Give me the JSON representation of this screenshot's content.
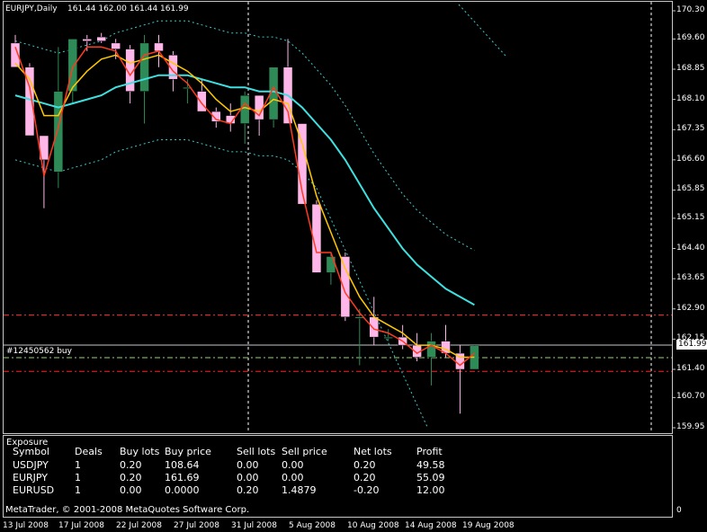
{
  "header": {
    "symbol_period": "EURJPY,Daily",
    "ohlc": "161.44 162.00 161.44 161.99"
  },
  "price_axis": {
    "ticks": [
      "170.30",
      "169.60",
      "168.85",
      "168.10",
      "167.35",
      "166.60",
      "165.85",
      "165.15",
      "164.40",
      "163.65",
      "162.90",
      "162.15",
      "161.40",
      "160.70",
      "159.95"
    ],
    "current_price": "161.99",
    "range": [
      159.95,
      170.3
    ]
  },
  "time_axis": {
    "ticks": [
      "13 Jul 2008",
      "17 Jul 2008",
      "22 Jul 2008",
      "27 Jul 2008",
      "31 Jul 2008",
      "5 Aug 2008",
      "10 Aug 2008",
      "14 Aug 2008",
      "19 Aug 2008"
    ]
  },
  "order_line": {
    "label": "#12450562 buy",
    "open_price": 161.69
  },
  "levels": {
    "resistance_red": 162.75,
    "support_red": 161.35
  },
  "colors": {
    "bull_candle": "#2e8b57",
    "bear_candle": "#ffb6e8",
    "ema_fast": "#ff3b1f",
    "ema_slow": "#ffc800",
    "ma_long": "#3ee0e0",
    "band": "#3ec8c8",
    "level_line": "#ff2020",
    "order_line": "#9bd46b",
    "vertical_separator": "#ffffff"
  },
  "exposure": {
    "title": "Exposure",
    "columns": [
      "Symbol",
      "Deals",
      "Buy lots",
      "Buy price",
      "Sell lots",
      "Sell price",
      "Net lots",
      "Profit"
    ],
    "rows": [
      [
        "USDJPY",
        "1",
        "0.20",
        "108.64",
        "0.00",
        "0.00",
        "0.20",
        "49.58"
      ],
      [
        "EURJPY",
        "1",
        "0.20",
        "161.69",
        "0.00",
        "0.00",
        "0.20",
        "55.09"
      ],
      [
        "EURUSD",
        "1",
        "0.00",
        "0.0000",
        "0.20",
        "1.4879",
        "-0.20",
        "12.00"
      ]
    ],
    "footer": "MetaTrader, © 2001-2008 MetaQuotes Software Corp.",
    "scale_label": "0"
  },
  "candles": [
    {
      "o": 169.5,
      "h": 169.7,
      "l": 168.9,
      "c": 168.9
    },
    {
      "o": 168.9,
      "h": 169.0,
      "l": 167.2,
      "c": 167.2
    },
    {
      "o": 167.2,
      "h": 166.65,
      "l": 165.4,
      "c": 166.6
    },
    {
      "o": 166.3,
      "h": 169.4,
      "l": 165.9,
      "c": 168.3
    },
    {
      "o": 168.3,
      "h": 169.6,
      "l": 168.0,
      "c": 169.6
    },
    {
      "o": 169.6,
      "h": 169.7,
      "l": 169.3,
      "c": 169.55
    },
    {
      "o": 169.65,
      "h": 169.75,
      "l": 169.5,
      "c": 169.55
    },
    {
      "o": 169.5,
      "h": 169.6,
      "l": 169.1,
      "c": 169.35
    },
    {
      "o": 169.35,
      "h": 169.45,
      "l": 168.0,
      "c": 168.3
    },
    {
      "o": 168.3,
      "h": 169.7,
      "l": 167.5,
      "c": 169.5
    },
    {
      "o": 169.5,
      "h": 169.7,
      "l": 168.9,
      "c": 169.3
    },
    {
      "o": 169.2,
      "h": 169.3,
      "l": 168.3,
      "c": 168.6
    },
    {
      "o": 168.4,
      "h": 168.6,
      "l": 168.0,
      "c": 168.4
    },
    {
      "o": 168.3,
      "h": 168.6,
      "l": 167.8,
      "c": 167.8
    },
    {
      "o": 167.8,
      "h": 167.9,
      "l": 167.4,
      "c": 167.55
    },
    {
      "o": 167.7,
      "h": 168.0,
      "l": 167.3,
      "c": 167.5
    },
    {
      "o": 167.5,
      "h": 168.3,
      "l": 167.0,
      "c": 168.2
    },
    {
      "o": 168.2,
      "h": 168.2,
      "l": 167.2,
      "c": 167.6
    },
    {
      "o": 167.6,
      "h": 168.9,
      "l": 167.4,
      "c": 168.9
    },
    {
      "o": 168.9,
      "h": 169.6,
      "l": 167.5,
      "c": 167.5
    },
    {
      "o": 167.5,
      "h": 167.5,
      "l": 165.5,
      "c": 165.5
    },
    {
      "o": 165.5,
      "h": 165.6,
      "l": 163.8,
      "c": 163.8
    },
    {
      "o": 163.8,
      "h": 164.3,
      "l": 163.5,
      "c": 164.2
    },
    {
      "o": 164.2,
      "h": 164.3,
      "l": 162.6,
      "c": 162.7
    },
    {
      "o": 162.7,
      "h": 162.9,
      "l": 161.5,
      "c": 162.7
    },
    {
      "o": 162.7,
      "h": 163.2,
      "l": 162.0,
      "c": 162.2
    },
    {
      "o": 162.2,
      "h": 162.4,
      "l": 162.1,
      "c": 162.2
    },
    {
      "o": 162.2,
      "h": 162.5,
      "l": 161.9,
      "c": 162.0
    },
    {
      "o": 162.0,
      "h": 162.3,
      "l": 161.6,
      "c": 161.7
    },
    {
      "o": 161.7,
      "h": 162.3,
      "l": 161.0,
      "c": 162.1
    },
    {
      "o": 162.1,
      "h": 162.5,
      "l": 161.7,
      "c": 161.8
    },
    {
      "o": 161.8,
      "h": 162.0,
      "l": 160.3,
      "c": 161.4
    },
    {
      "o": 161.4,
      "h": 162.0,
      "l": 161.4,
      "c": 161.99
    }
  ],
  "ema_fast": [
    169.4,
    168.4,
    166.2,
    167.4,
    168.9,
    169.4,
    169.4,
    169.3,
    168.7,
    169.2,
    169.3,
    168.8,
    168.5,
    168.0,
    167.6,
    167.5,
    168.0,
    167.7,
    168.4,
    167.8,
    165.8,
    164.3,
    164.3,
    163.3,
    162.8,
    162.4,
    162.3,
    162.1,
    161.8,
    162.0,
    161.8,
    161.5,
    161.8
  ],
  "ema_slow": [
    169.0,
    168.6,
    167.7,
    167.7,
    168.4,
    168.8,
    169.1,
    169.2,
    169.0,
    169.1,
    169.2,
    169.0,
    168.8,
    168.5,
    168.1,
    167.8,
    167.9,
    167.8,
    168.1,
    168.0,
    167.0,
    165.7,
    164.8,
    163.9,
    163.2,
    162.7,
    162.5,
    162.3,
    162.0,
    162.0,
    161.9,
    161.7,
    161.7
  ],
  "ma_long": [
    168.2,
    168.1,
    168.0,
    167.9,
    168.0,
    168.1,
    168.2,
    168.4,
    168.5,
    168.6,
    168.7,
    168.7,
    168.7,
    168.6,
    168.5,
    168.4,
    168.4,
    168.3,
    168.3,
    168.2,
    167.9,
    167.5,
    167.1,
    166.6,
    166.0,
    165.4,
    164.9,
    164.4,
    164.0,
    163.7,
    163.4,
    163.2,
    163.0
  ]
}
